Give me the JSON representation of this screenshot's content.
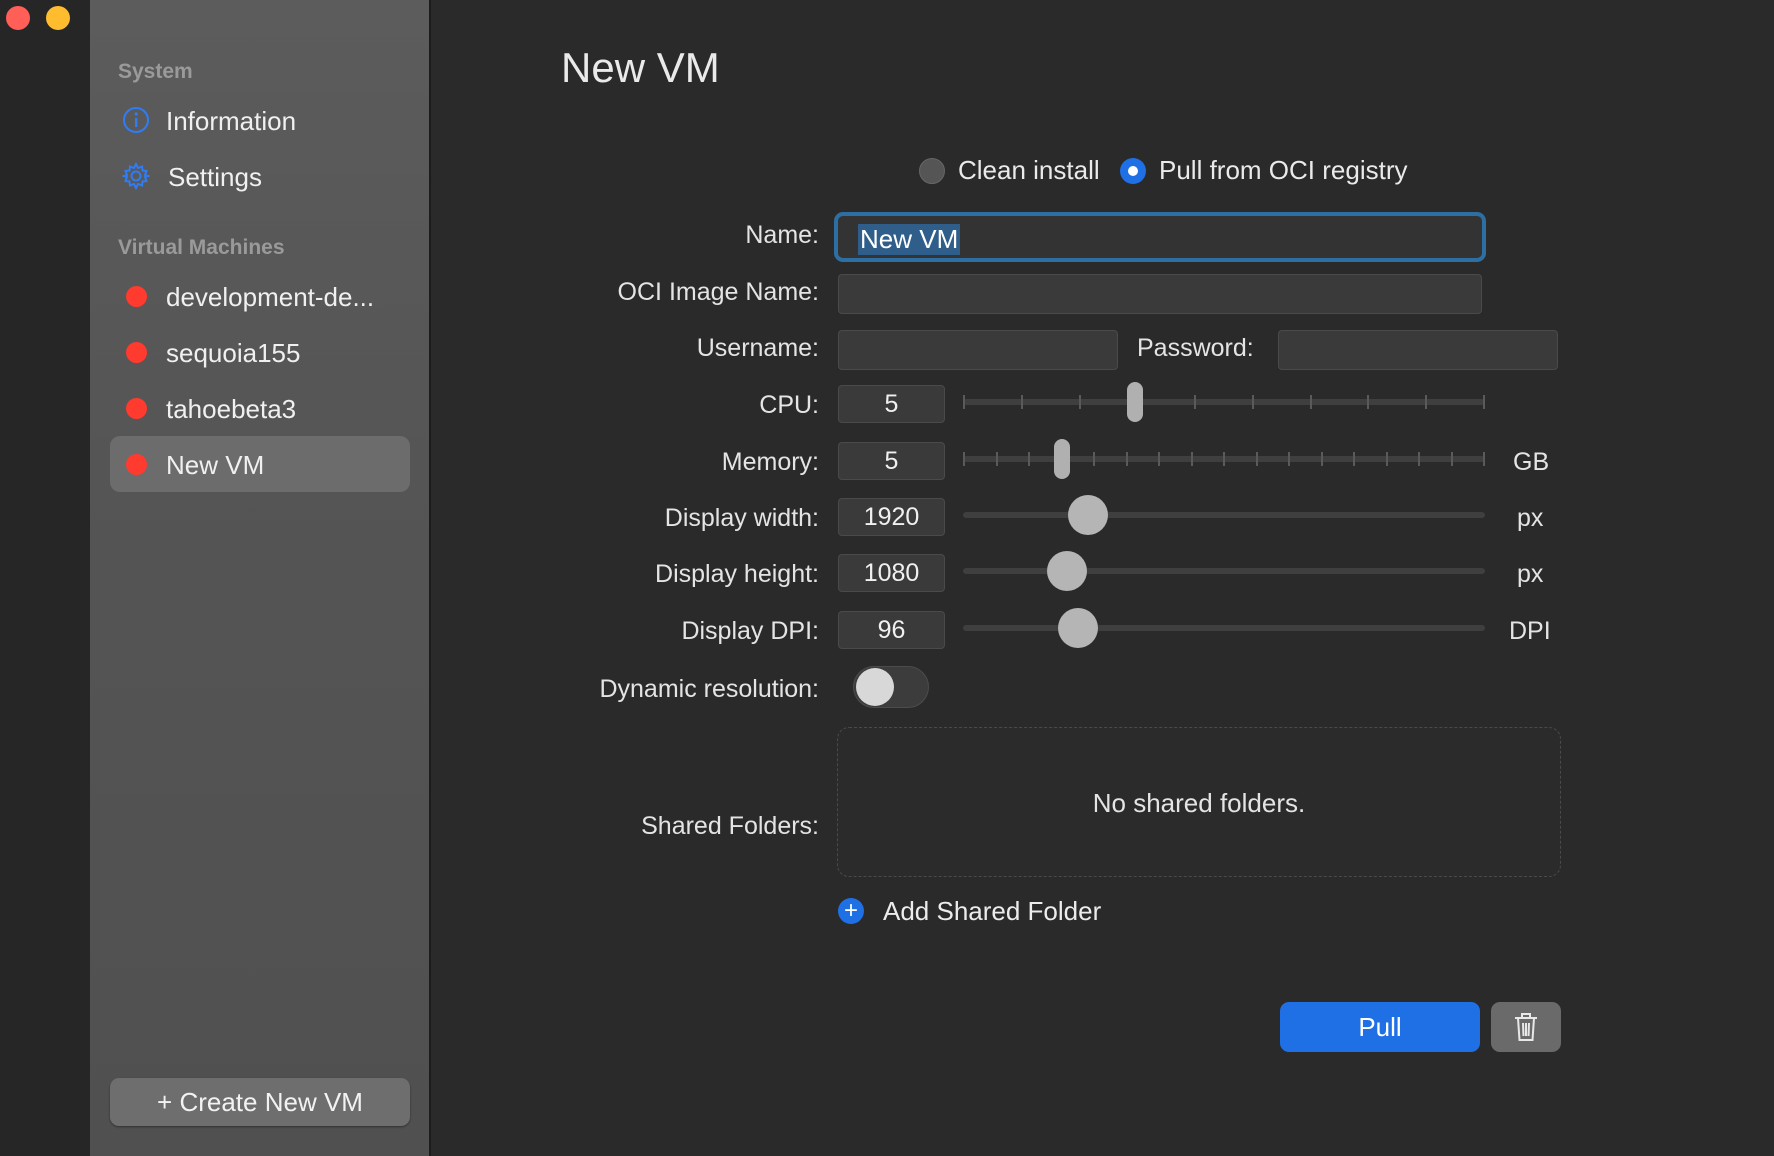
{
  "window": {
    "traffic_lights": [
      "close",
      "minimize"
    ]
  },
  "sidebar": {
    "system_header": "System",
    "system_items": [
      {
        "label": "Information",
        "icon": "info-icon"
      },
      {
        "label": "Settings",
        "icon": "gear-icon"
      }
    ],
    "vm_header": "Virtual Machines",
    "vms": [
      {
        "label": "development-de...",
        "status_color": "#ff3b30"
      },
      {
        "label": "sequoia155",
        "status_color": "#ff3b30"
      },
      {
        "label": "tahoebeta3",
        "status_color": "#ff3b30"
      },
      {
        "label": "New VM",
        "status_color": "#ff3b30",
        "selected": true
      }
    ],
    "create_label": "+ Create New VM"
  },
  "main": {
    "title": "New VM",
    "source": {
      "clean_label": "Clean install",
      "oci_label": "Pull from OCI registry",
      "selected": "oci"
    },
    "name": {
      "label": "Name:",
      "value": "New VM"
    },
    "oci_image": {
      "label": "OCI Image Name:",
      "value": ""
    },
    "username": {
      "label": "Username:",
      "value": ""
    },
    "password": {
      "label": "Password:",
      "value": ""
    },
    "cpu": {
      "label": "CPU:",
      "value": "5",
      "fraction": 0.33
    },
    "memory": {
      "label": "Memory:",
      "value": "5",
      "unit": "GB",
      "fraction": 0.19
    },
    "display_width": {
      "label": "Display width:",
      "value": "1920",
      "unit": "px",
      "fraction": 0.24
    },
    "display_height": {
      "label": "Display height:",
      "value": "1080",
      "unit": "px",
      "fraction": 0.2
    },
    "display_dpi": {
      "label": "Display DPI:",
      "value": "96",
      "unit": "DPI",
      "fraction": 0.22
    },
    "dynamic_resolution": {
      "label": "Dynamic resolution:",
      "enabled": false
    },
    "shared_folders": {
      "label": "Shared Folders:",
      "empty_text": "No shared folders.",
      "add_label": "Add Shared Folder"
    },
    "pull_label": "Pull",
    "accent_color": "#1f6fe5"
  }
}
